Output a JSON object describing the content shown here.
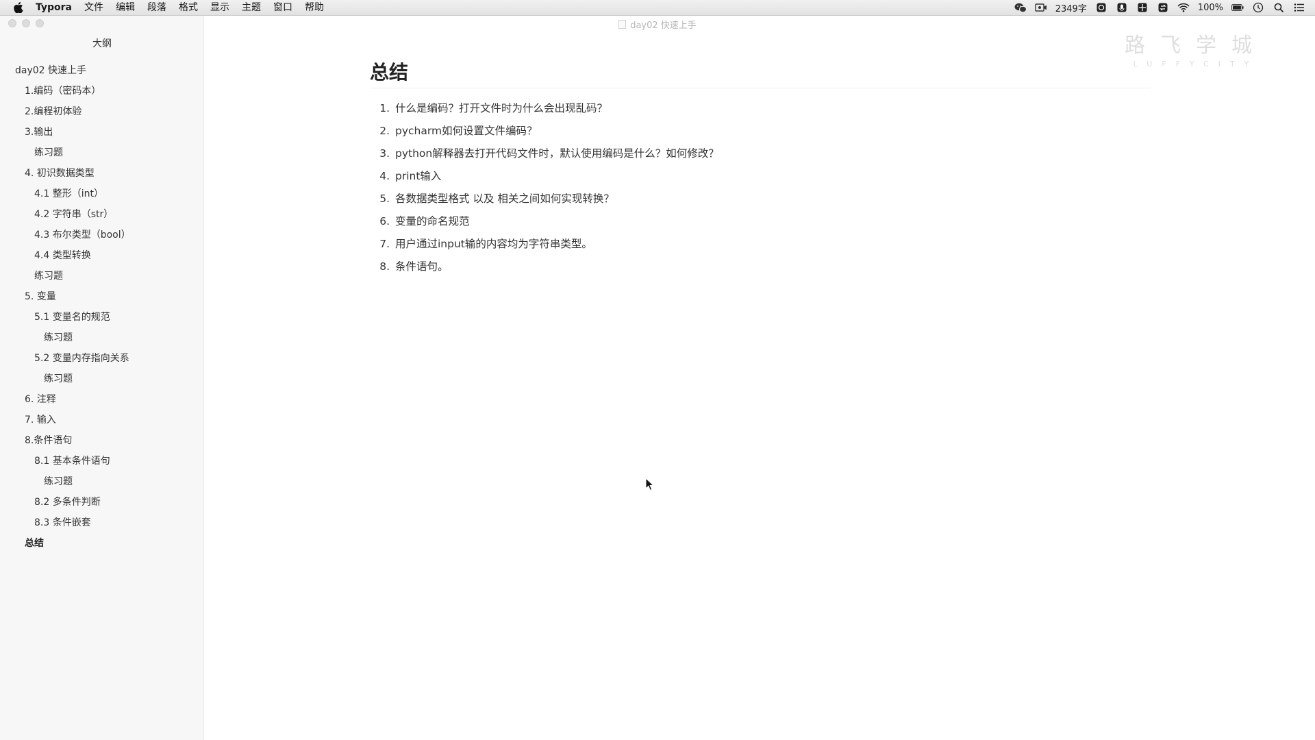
{
  "menubar": {
    "app": "Typora",
    "items": [
      "文件",
      "编辑",
      "段落",
      "格式",
      "显示",
      "主题",
      "窗口",
      "帮助"
    ],
    "status": {
      "word_count": "2349字",
      "battery": "100%"
    },
    "icons": [
      "wechat-icon",
      "screen-record-icon",
      "word-count-icon",
      "privacy-icon",
      "grid-icon",
      "sync-icon",
      "wifi-icon",
      "battery-icon",
      "clock-icon",
      "spotlight-icon",
      "notification-center-icon"
    ]
  },
  "window": {
    "title": "day02 快速上手"
  },
  "sidebar": {
    "title": "大纲",
    "items": [
      {
        "label": "day02 快速上手",
        "level": 0
      },
      {
        "label": "1.编码（密码本）",
        "level": 1
      },
      {
        "label": "2.编程初体验",
        "level": 1
      },
      {
        "label": "3.输出",
        "level": 1
      },
      {
        "label": "练习题",
        "level": 2
      },
      {
        "label": "4. 初识数据类型",
        "level": 1
      },
      {
        "label": "4.1 整形（int）",
        "level": 2
      },
      {
        "label": "4.2 字符串（str）",
        "level": 2
      },
      {
        "label": "4.3 布尔类型（bool）",
        "level": 2
      },
      {
        "label": "4.4 类型转换",
        "level": 2
      },
      {
        "label": "练习题",
        "level": 2
      },
      {
        "label": "5. 变量",
        "level": 1
      },
      {
        "label": "5.1 变量名的规范",
        "level": 2
      },
      {
        "label": "练习题",
        "level": 3
      },
      {
        "label": "5.2 变量内存指向关系",
        "level": 2
      },
      {
        "label": "练习题",
        "level": 3
      },
      {
        "label": "6. 注释",
        "level": 1
      },
      {
        "label": "7. 输入",
        "level": 1
      },
      {
        "label": "8.条件语句",
        "level": 1
      },
      {
        "label": "8.1 基本条件语句",
        "level": 2
      },
      {
        "label": "练习题",
        "level": 3
      },
      {
        "label": "8.2 多条件判断",
        "level": 2
      },
      {
        "label": "8.3 条件嵌套",
        "level": 2
      },
      {
        "label": "总结",
        "level": 1,
        "active": true
      }
    ]
  },
  "watermark": {
    "cn": "路飞学城",
    "en": "LUFFYCITY"
  },
  "document": {
    "heading": "总结",
    "list": [
      {
        "num": "1.",
        "text": "什么是编码？打开文件时为什么会出现乱码？"
      },
      {
        "num": "2.",
        "text": "pycharm如何设置文件编码？"
      },
      {
        "num": "3.",
        "text": "python解释器去打开代码文件时，默认使用编码是什么？如何修改？"
      },
      {
        "num": "4.",
        "text": "print输入"
      },
      {
        "num": "5.",
        "text": "各数据类型格式 以及 相关之间如何实现转换？"
      },
      {
        "num": "6.",
        "text": "变量的命名规范"
      },
      {
        "num": "7.",
        "text": "用户通过input输的内容均为字符串类型。"
      },
      {
        "num": "8.",
        "text": "条件语句。"
      }
    ]
  }
}
